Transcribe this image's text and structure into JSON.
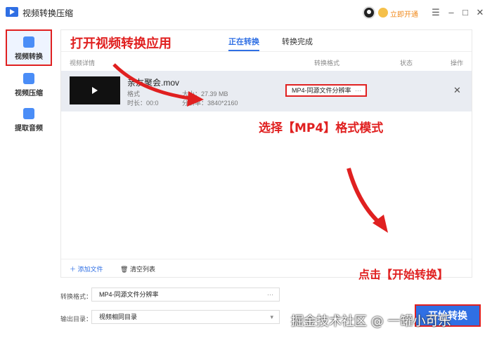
{
  "window": {
    "title": "视频转换压缩",
    "vip_label": "立即开通",
    "controls": [
      "☰",
      "–",
      "□",
      "✕"
    ]
  },
  "sidebar": {
    "items": [
      {
        "label": "视频转换",
        "icon": "convert-icon"
      },
      {
        "label": "视频压缩",
        "icon": "compress-icon"
      },
      {
        "label": "提取音频",
        "icon": "audio-icon"
      }
    ]
  },
  "tabs": [
    "正在转换",
    "转换完成"
  ],
  "table": {
    "headers": [
      "视频详情",
      "转换格式",
      "状态",
      "操作"
    ],
    "rows": [
      {
        "filename": "亲友聚会.mov",
        "format_label": "格式",
        "size": "大小：27.39 MB",
        "duration_label": "时长：00:0",
        "resolution": "分辨率：3840*2160",
        "target_format": "MP4-同源文件分辨率"
      }
    ]
  },
  "actions": {
    "add_file": "添加文件",
    "clear_list": "清空列表"
  },
  "settings": {
    "format_label": "转换格式：",
    "format_value": "MP4-同源文件分辨率",
    "format_trail": "···",
    "output_label": "输出目录：",
    "output_value": "视频相同目录",
    "output_trail": "▾"
  },
  "start_button": "开始转换",
  "annotations": {
    "open_app": "打开视频转换应用",
    "select_format": "选择【MP4】格式模式",
    "click_start": "点击【开始转换】"
  },
  "watermark": "掘金技术社区 @ 一罐小可乐",
  "colors": {
    "accent": "#2f6fe4",
    "highlight": "#e02020"
  }
}
